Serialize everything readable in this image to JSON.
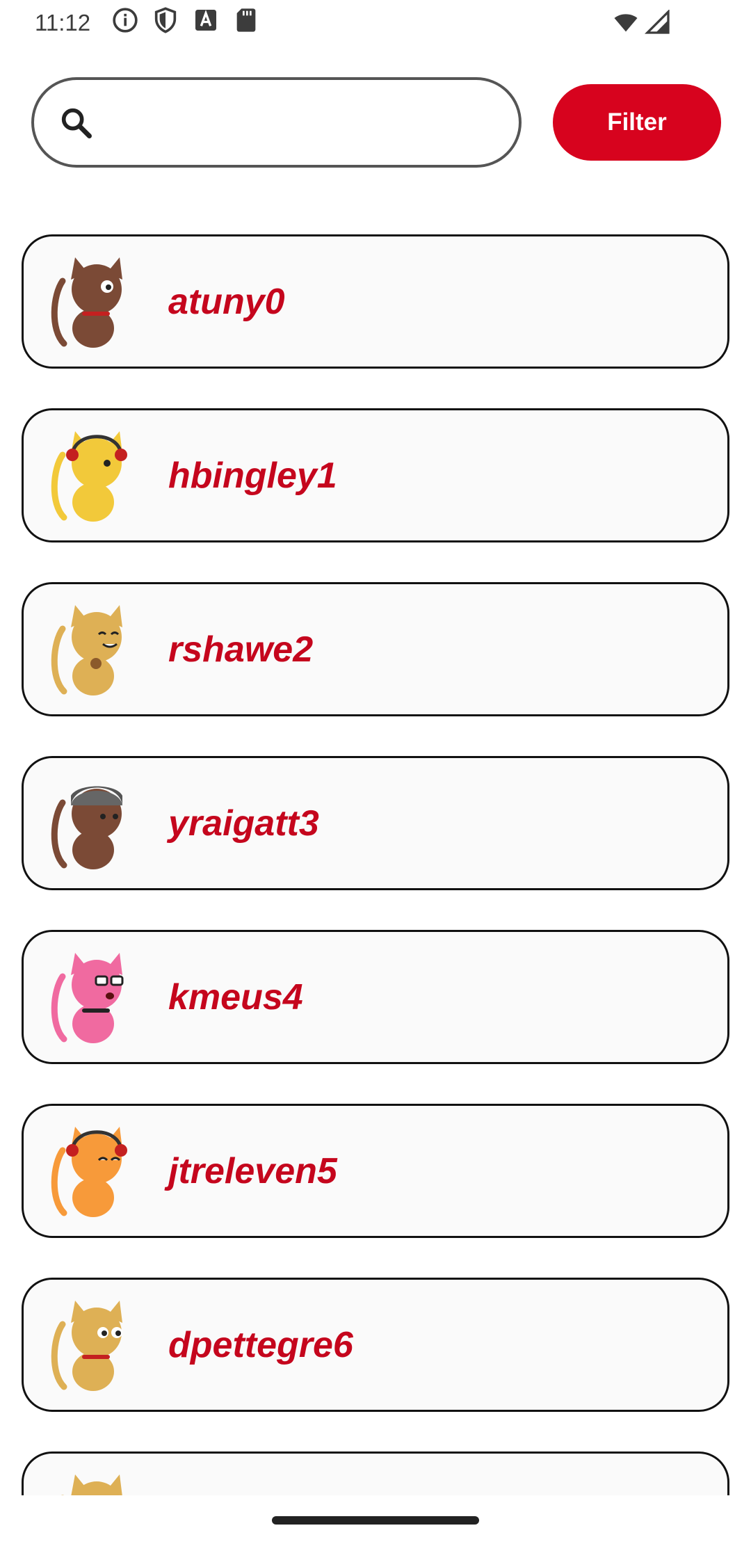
{
  "status_bar": {
    "time": "11:12",
    "icons": [
      "info-icon",
      "shield-icon",
      "font-a-icon",
      "sd-card-icon",
      "wifi-icon",
      "signal-icon"
    ]
  },
  "search": {
    "placeholder": "",
    "value": ""
  },
  "toolbar": {
    "filter_label": "Filter"
  },
  "colors": {
    "accent": "#d7031e",
    "username_text": "#c5061d",
    "card_border": "#111111",
    "card_background": "#fafafa"
  },
  "users": [
    {
      "username": "atuny0",
      "avatar_color": "#7b4a36"
    },
    {
      "username": "hbingley1",
      "avatar_color": "#f2c93a"
    },
    {
      "username": "rshawe2",
      "avatar_color": "#deb055"
    },
    {
      "username": "yraigatt3",
      "avatar_color": "#7b4a36"
    },
    {
      "username": "kmeus4",
      "avatar_color": "#f06aa0"
    },
    {
      "username": "jtreleven5",
      "avatar_color": "#f79a3a"
    },
    {
      "username": "dpettegre6",
      "avatar_color": "#deb055"
    },
    {
      "username": "",
      "avatar_color": "#deb055"
    }
  ]
}
